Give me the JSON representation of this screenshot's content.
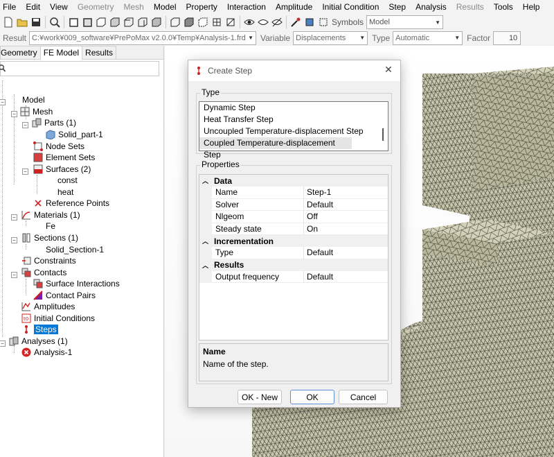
{
  "menu": {
    "items": [
      {
        "label": "File",
        "enabled": true
      },
      {
        "label": "Edit",
        "enabled": true
      },
      {
        "label": "View",
        "enabled": true
      },
      {
        "label": "Geometry",
        "enabled": false
      },
      {
        "label": "Mesh",
        "enabled": false
      },
      {
        "label": "Model",
        "enabled": true
      },
      {
        "label": "Property",
        "enabled": true
      },
      {
        "label": "Interaction",
        "enabled": true
      },
      {
        "label": "Amplitude",
        "enabled": true
      },
      {
        "label": "Initial Condition",
        "enabled": true
      },
      {
        "label": "Step",
        "enabled": true
      },
      {
        "label": "Analysis",
        "enabled": true
      },
      {
        "label": "Results",
        "enabled": false
      },
      {
        "label": "Tools",
        "enabled": true
      },
      {
        "label": "Help",
        "enabled": true
      }
    ]
  },
  "toolbar": {
    "symbols_label": "Symbols",
    "symbols_value": "Model"
  },
  "resultbar": {
    "result_label": "Result",
    "result_file": "C:¥work¥009_software¥PrePoMax v2.0.0¥Temp¥Analysis-1.frd",
    "variable_label": "Variable",
    "variable_value": "Displacements",
    "type_label": "Type",
    "type_value": "Automatic",
    "factor_label": "Factor",
    "factor_value": "10"
  },
  "left_panel": {
    "tabs": [
      "Geometry",
      "FE Model",
      "Results"
    ],
    "active_tab": "FE Model",
    "tree": {
      "model": "Model",
      "mesh": "Mesh",
      "parts": "Parts (1)",
      "solid_part": "Solid_part-1",
      "node_sets": "Node Sets",
      "element_sets": "Element Sets",
      "surfaces": "Surfaces (2)",
      "surf_const": "const",
      "surf_heat": "heat",
      "reference_points": "Reference Points",
      "materials": "Materials (1)",
      "mat_fe": "Fe",
      "sections": "Sections (1)",
      "solid_section": "Solid_Section-1",
      "constraints": "Constraints",
      "contacts": "Contacts",
      "surface_interactions": "Surface Interactions",
      "contact_pairs": "Contact Pairs",
      "amplitudes": "Amplitudes",
      "initial_conditions": "Initial Conditions",
      "steps": "Steps",
      "analyses": "Analyses (1)",
      "analysis_1": "Analysis-1"
    }
  },
  "dialog": {
    "title": "Create Step",
    "close": "✕",
    "type_group": "Type",
    "type_items": [
      "Dynamic Step",
      "Heat Transfer Step",
      "Uncoupled Temperature-displacement Step",
      "Coupled Temperature-displacement Step"
    ],
    "properties_group": "Properties",
    "categories": [
      {
        "name": "Data",
        "rows": [
          {
            "name": "Name",
            "value": "Step-1"
          },
          {
            "name": "Solver",
            "value": "Default"
          },
          {
            "name": "Nlgeom",
            "value": "Off"
          },
          {
            "name": "Steady state",
            "value": "On"
          }
        ]
      },
      {
        "name": "Incrementation",
        "rows": [
          {
            "name": "Type",
            "value": "Default"
          }
        ]
      },
      {
        "name": "Results",
        "rows": [
          {
            "name": "Output frequency",
            "value": "Default"
          }
        ]
      }
    ],
    "description_title": "Name",
    "description_text": "Name of the step.",
    "buttons": {
      "ok_new": "OK - New",
      "ok": "OK",
      "cancel": "Cancel"
    }
  },
  "colors": {
    "selection": "#0078d7",
    "mesh_fill": "#c8c8ad",
    "mesh_line": "#3d3d30"
  }
}
